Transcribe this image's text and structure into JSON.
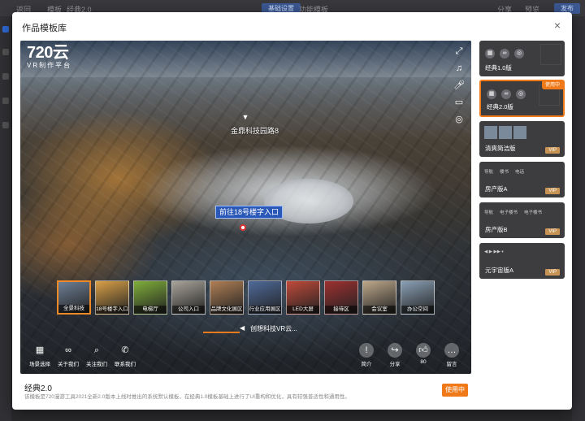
{
  "background_app": {
    "topbar_items": [
      "返回",
      "模板",
      "经典2.0"
    ],
    "tabs": [
      "基础设置",
      "功能模板"
    ],
    "right_items": [
      "分享",
      "预览",
      "发布"
    ]
  },
  "modal": {
    "title": "作品模板库",
    "close_icon": "×"
  },
  "preview": {
    "logo_big": "720云",
    "logo_small": "VR制作平台",
    "right_icons": [
      "fullscreen-icon",
      "music-icon",
      "voice-icon",
      "vr-glasses-icon",
      "gyroscope-icon"
    ],
    "hotspot_label": "金鼎科技园路8",
    "entry_tag": "前往18号楼字入口",
    "thumbnails": [
      {
        "label": "全景科技",
        "color": "#6e7f96",
        "active": true
      },
      {
        "label": "18号楼字入口",
        "color": "#d9a047",
        "active": false
      },
      {
        "label": "电梯厅",
        "color": "#7fae3a",
        "active": false
      },
      {
        "label": "公司入口",
        "color": "#a8a39a",
        "active": false
      },
      {
        "label": "品牌文化展区",
        "color": "#b07f55",
        "active": false
      },
      {
        "label": "行业应用展区",
        "color": "#4f6a9a",
        "active": false
      },
      {
        "label": "LED大屏",
        "color": "#c04a3a",
        "active": false
      },
      {
        "label": "接待区",
        "color": "#9e3030",
        "active": false
      },
      {
        "label": "会议室",
        "color": "#bda88a",
        "active": false
      },
      {
        "label": "办公空间",
        "color": "#8aa0b5",
        "active": false
      }
    ],
    "scroll_text": "创想科技VR云...",
    "bottom_buttons_left": [
      {
        "label": "场景选择",
        "icon": "grid-icon"
      },
      {
        "label": "关于我们",
        "icon": "link-icon"
      },
      {
        "label": "关注我们",
        "icon": "search-icon"
      },
      {
        "label": "联系我们",
        "icon": "phone-icon"
      }
    ],
    "bottom_buttons_right": [
      {
        "label": "简介",
        "icon": "info-icon"
      },
      {
        "label": "分享",
        "icon": "share-icon"
      },
      {
        "label": "80",
        "icon": "like-icon"
      },
      {
        "label": "留言",
        "icon": "comment-icon"
      }
    ]
  },
  "info": {
    "title": "经典2.0",
    "description": "该模板是720漫游工具2021全新2.0版本上线时推出的系统默认模板，在经典1.0模板基础上进行了UI重构和优化，具有较强普适性和通用性。",
    "button_label": "使用中"
  },
  "templates": [
    {
      "name": "经典1.0版",
      "kind": "icons",
      "selected": false,
      "in_use": false,
      "vip": false
    },
    {
      "name": "经典2.0版",
      "kind": "icons",
      "selected": true,
      "in_use": true,
      "in_use_label": "使用中",
      "vip": false
    },
    {
      "name": "清爽简洁版",
      "kind": "strip",
      "selected": false,
      "in_use": false,
      "vip": true
    },
    {
      "name": "房产版A",
      "kind": "menu",
      "menu": [
        "导航",
        "楼书",
        "电话"
      ],
      "selected": false,
      "in_use": false,
      "vip": true
    },
    {
      "name": "房产版B",
      "kind": "menu",
      "menu": [
        "导航",
        "电子楼书",
        "电子楼书"
      ],
      "selected": false,
      "in_use": false,
      "vip": true
    },
    {
      "name": "元宇宙版A",
      "kind": "player",
      "selected": false,
      "in_use": false,
      "vip": true
    }
  ],
  "vip_label": "VIP",
  "colors": {
    "accent": "#f07a1a",
    "tag_blue": "#2a58b8"
  }
}
